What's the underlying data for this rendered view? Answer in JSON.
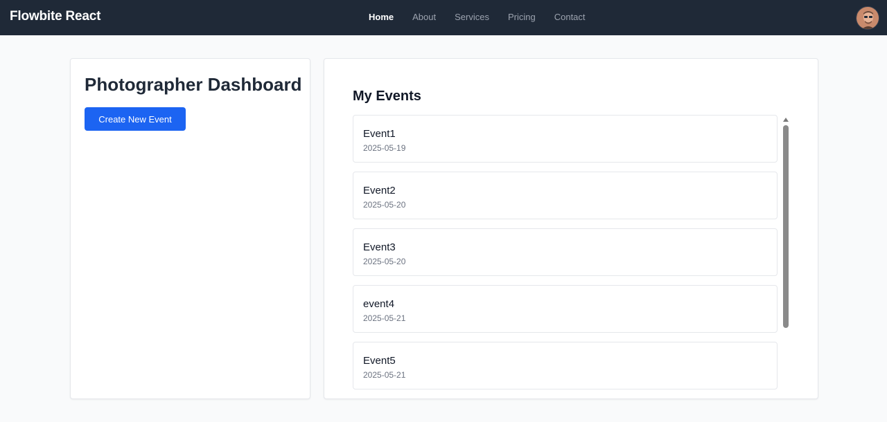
{
  "navbar": {
    "brand": "Flowbite React",
    "links": [
      {
        "label": "Home",
        "active": true
      },
      {
        "label": "About",
        "active": false
      },
      {
        "label": "Services",
        "active": false
      },
      {
        "label": "Pricing",
        "active": false
      },
      {
        "label": "Contact",
        "active": false
      }
    ],
    "avatar_icon": "user-avatar"
  },
  "sidebar": {
    "title": "Photographer Dashboard",
    "create_button_label": "Create New Event"
  },
  "events": {
    "title": "My Events",
    "items": [
      {
        "name": "Event1",
        "date": "2025-05-19"
      },
      {
        "name": "Event2",
        "date": "2025-05-20"
      },
      {
        "name": "Event3",
        "date": "2025-05-20"
      },
      {
        "name": "event4",
        "date": "2025-05-21"
      },
      {
        "name": "Event5",
        "date": "2025-05-21"
      }
    ]
  },
  "colors": {
    "navbar_bg": "#1f2937",
    "primary": "#1c64f2",
    "page_bg": "#f9fafb"
  }
}
